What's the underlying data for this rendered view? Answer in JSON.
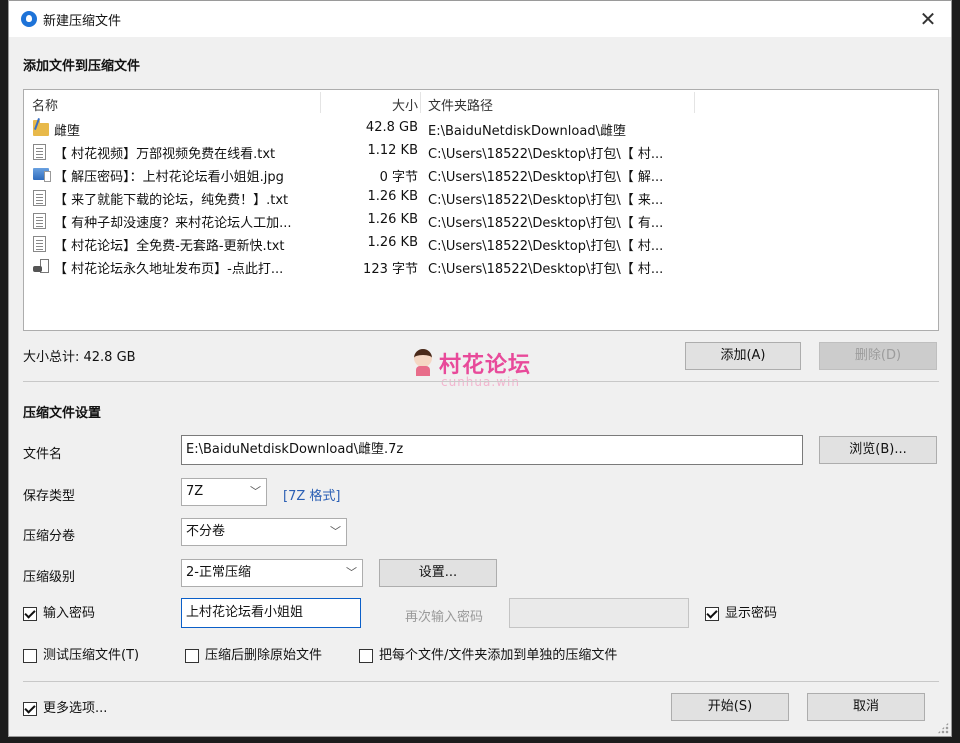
{
  "window": {
    "title": "新建压缩文件"
  },
  "files_section": {
    "heading": "添加文件到压缩文件",
    "columns": {
      "name": "名称",
      "size": "大小",
      "path": "文件夹路径"
    },
    "rows": [
      {
        "icon": "folder-icon",
        "name": "雌堕",
        "size": "42.8 GB",
        "path": "E:\\BaiduNetdiskDownload\\雌堕"
      },
      {
        "icon": "text-file-icon",
        "name": "【 村花视频】万部视频免费在线看.txt",
        "size": "1.12 KB",
        "path": "C:\\Users\\18522\\Desktop\\打包\\【 村..."
      },
      {
        "icon": "image-file-icon",
        "name": "【 解压密码】：上村花论坛看小姐姐.jpg",
        "size": "0 字节",
        "path": "C:\\Users\\18522\\Desktop\\打包\\【 解..."
      },
      {
        "icon": "text-file-icon",
        "name": "【 来了就能下载的论坛，纯免费！】.txt",
        "size": "1.26 KB",
        "path": "C:\\Users\\18522\\Desktop\\打包\\【 来..."
      },
      {
        "icon": "text-file-icon",
        "name": "【 有种子却没速度？来村花论坛人工加...",
        "size": "1.26 KB",
        "path": "C:\\Users\\18522\\Desktop\\打包\\【 有..."
      },
      {
        "icon": "text-file-icon",
        "name": "【 村花论坛】全免费-无套路-更新快.txt",
        "size": "1.26 KB",
        "path": "C:\\Users\\18522\\Desktop\\打包\\【 村..."
      },
      {
        "icon": "shortcut-file-icon",
        "name": "【 村花论坛永久地址发布页】-点此打...",
        "size": "123 字节",
        "path": "C:\\Users\\18522\\Desktop\\打包\\【 村..."
      }
    ],
    "total_size": "大小总计: 42.8 GB",
    "add_button": "添加(A)",
    "delete_button": "删除(D)"
  },
  "watermark": {
    "text": "村花论坛",
    "subtext": "cunhua.win"
  },
  "settings": {
    "heading": "压缩文件设置",
    "filename_label": "文件名",
    "filename_value": "E:\\BaiduNetdiskDownload\\雌堕.7z",
    "browse_button": "浏览(B)...",
    "save_type_label": "保存类型",
    "save_type_value": "7Z",
    "save_type_format": "[7Z 格式]",
    "split_label": "压缩分卷",
    "split_value": "不分卷",
    "level_label": "压缩级别",
    "level_value": "2-正常压缩",
    "level_settings_button": "设置...",
    "password_checkbox": "输入密码",
    "password_value": "上村花论坛看小姐姐",
    "password_repeat_label": "再次输入密码",
    "show_password_checkbox": "显示密码",
    "test_checkbox": "测试压缩文件(T)",
    "delete_after_checkbox": "压缩后删除原始文件",
    "separate_archives_checkbox": "把每个文件/文件夹添加到单独的压缩文件",
    "more_options_checkbox": "更多选项...",
    "start_button": "开始(S)",
    "cancel_button": "取消"
  },
  "checkbox_states": {
    "password": true,
    "show_password": true,
    "test": false,
    "delete_after": false,
    "separate_archives": false,
    "more_options": true
  },
  "colors": {
    "accent": "#1e73d8",
    "watermark": "#e84a9a",
    "link": "#2b5fb4"
  }
}
